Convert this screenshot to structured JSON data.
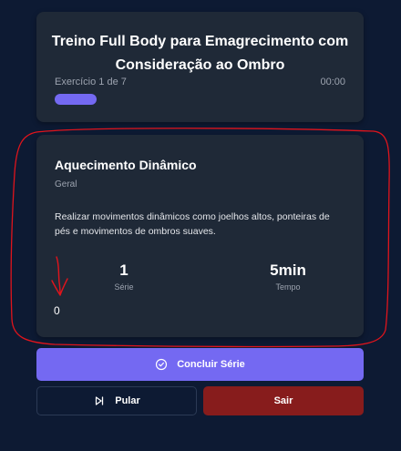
{
  "header": {
    "title": "Treino Full Body para Emagrecimento com Consideração ao Ombro",
    "exercise_counter": "Exercício 1 de 7",
    "timer": "00:00",
    "progress_fraction": 0.143
  },
  "exercise": {
    "name": "Aquecimento Dinâmico",
    "category": "Geral",
    "description": "Realizar movimentos dinâmicos como joelhos altos, ponteiras de pés e movimentos de ombros suaves.",
    "series_value": "1",
    "series_label": "Série",
    "time_value": "5min",
    "time_label": "Tempo",
    "counter": "0"
  },
  "actions": {
    "complete_label": "Concluir Série",
    "complete_icon": "check-circle-icon",
    "skip_label": "Pular",
    "skip_icon": "skip-forward-icon",
    "exit_label": "Sair"
  },
  "colors": {
    "background": "#0d1a33",
    "card": "#1f2937",
    "accent": "#7469f2",
    "danger": "#871c1c",
    "annotation": "#e0141c"
  }
}
